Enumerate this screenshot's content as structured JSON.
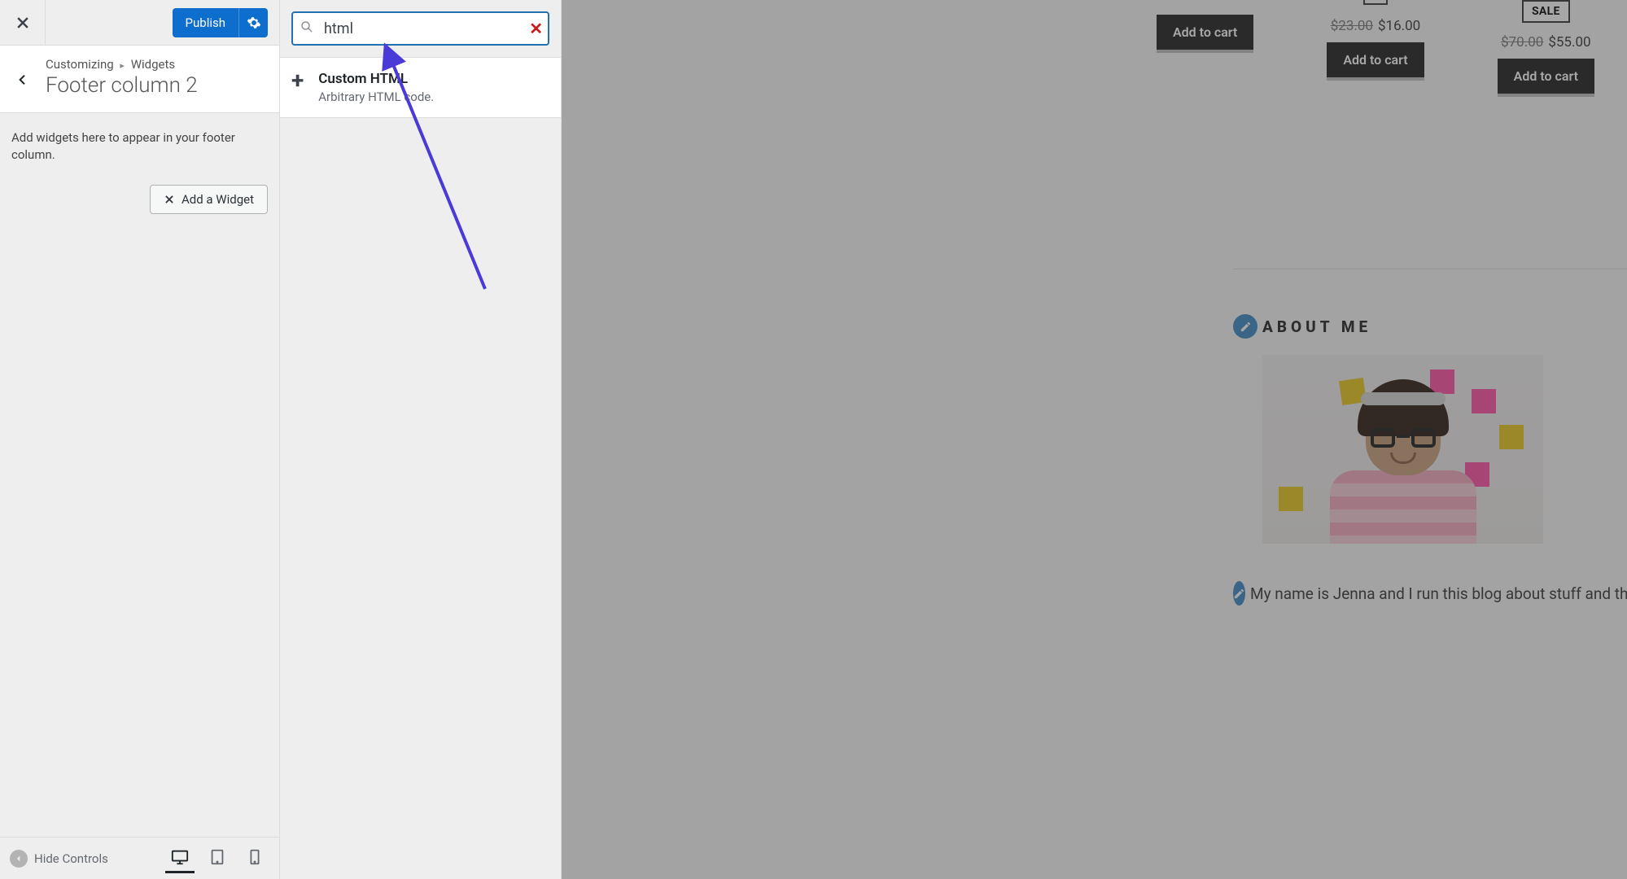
{
  "header": {
    "publish_label": "Publish"
  },
  "breadcrumb": {
    "level1": "Customizing",
    "level2": "Widgets",
    "title": "Footer column 2"
  },
  "help_text": "Add widgets here to appear in your footer column.",
  "add_widget_label": "Add a Widget",
  "footer": {
    "hide_controls": "Hide Controls"
  },
  "picker": {
    "search_value": "html",
    "results": [
      {
        "title": "Custom HTML",
        "sub": "Arbitrary HTML code."
      }
    ]
  },
  "preview": {
    "products": [
      {
        "sale": false,
        "old": "",
        "new": "",
        "btn": "Add to cart"
      },
      {
        "sale": false,
        "old": "$23.00",
        "new": "$16.00",
        "btn": "Add to cart"
      },
      {
        "sale": true,
        "sale_label": "SALE",
        "old": "$70.00",
        "new": "$55.00",
        "btn": "Add to cart"
      }
    ],
    "about_title": "ABOUT ME",
    "bio": "My name is Jenna and I run this blog about stuff and things. Feel free to reach out if you hav"
  }
}
